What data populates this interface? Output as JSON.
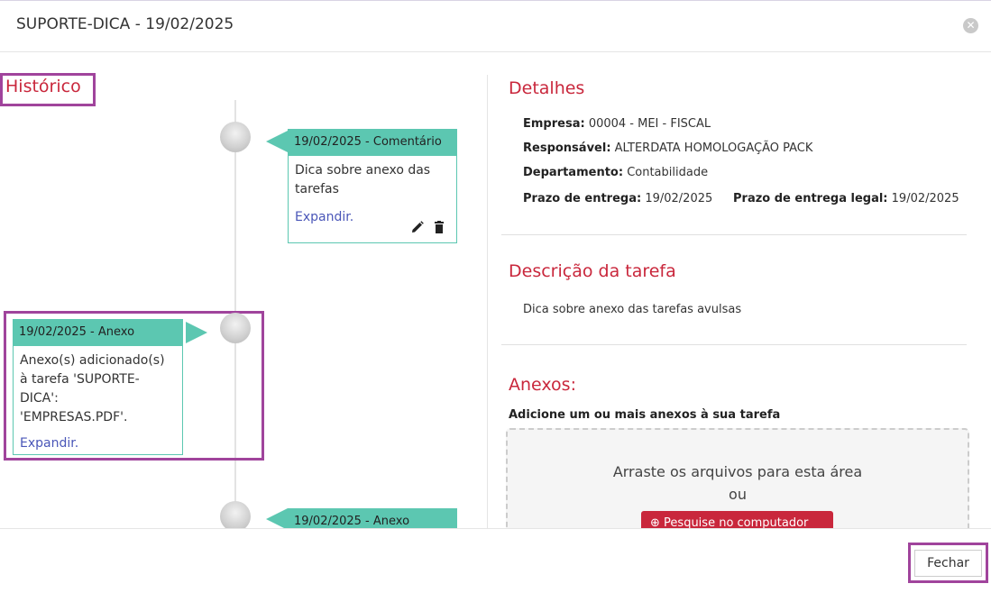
{
  "modal": {
    "title": "SUPORTE-DICA - 19/02/2025",
    "close_icon": "close-icon"
  },
  "historico": {
    "title": "Histórico",
    "entries": [
      {
        "header": "19/02/2025 - Comentário",
        "body": "Dica sobre anexo das tarefas",
        "expand_label": "Expandir.",
        "actions": [
          "pencil-icon",
          "trash-icon"
        ]
      },
      {
        "header": "19/02/2025 - Anexo",
        "body": "Anexo(s) adicionado(s) à tarefa 'SUPORTE-DICA': 'EMPRESAS.PDF'.",
        "expand_label": "Expandir."
      },
      {
        "header": "19/02/2025 - Anexo"
      }
    ]
  },
  "detalhes": {
    "title": "Detalhes",
    "empresa_label": "Empresa:",
    "empresa_value": "00004 - MEI - FISCAL",
    "responsavel_label": "Responsável:",
    "responsavel_value": "ALTERDATA HOMOLOGAÇÃO PACK",
    "departamento_label": "Departamento:",
    "departamento_value": "Contabilidade",
    "prazo_label": "Prazo de entrega:",
    "prazo_value": "19/02/2025",
    "prazo_legal_label": "Prazo de entrega legal:",
    "prazo_legal_value": "19/02/2025"
  },
  "descricao": {
    "title": "Descrição da tarefa",
    "text": "Dica sobre anexo das tarefas avulsas"
  },
  "anexos": {
    "title": "Anexos:",
    "subtitle": "Adicione um ou mais anexos à sua tarefa",
    "dropzone_text": "Arraste os arquivos para esta área",
    "dropzone_or": "ou",
    "search_button": "Pesquise no computador"
  },
  "footer": {
    "close_label": "Fechar"
  },
  "colors": {
    "accent_red": "#c9273c",
    "timeline_teal": "#5cc7b1",
    "link_blue": "#4a56b8",
    "highlight_purple": "#a0449c"
  }
}
